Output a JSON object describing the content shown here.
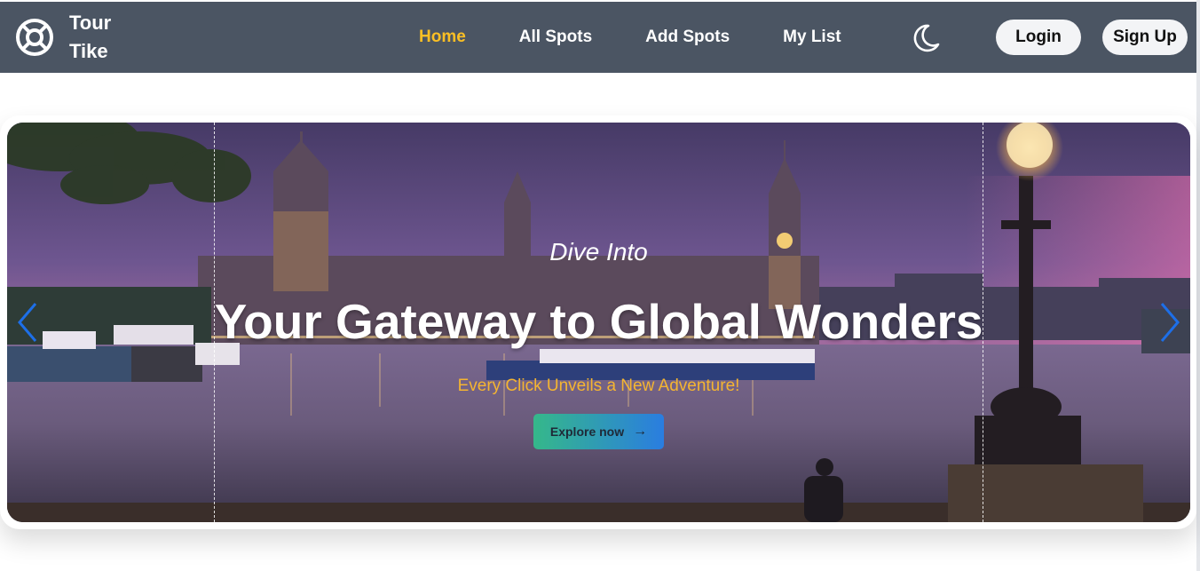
{
  "brand": {
    "line1": "Tour",
    "line2": "Tike",
    "icon": "lifebuoy-icon"
  },
  "nav": {
    "items": [
      {
        "label": "Home",
        "active": true
      },
      {
        "label": "All Spots",
        "active": false
      },
      {
        "label": "Add Spots",
        "active": false
      },
      {
        "label": "My List",
        "active": false
      }
    ],
    "theme_icon": "moon-icon",
    "login_label": "Login",
    "signup_label": "Sign Up"
  },
  "hero": {
    "subtitle": "Dive Into",
    "title": "Your Gateway to Global Wonders",
    "tagline": "Every Click Unveils a New Adventure!",
    "cta_label": "Explore now",
    "cta_icon": "arrow-right-icon",
    "prev_icon": "chevron-left-icon",
    "next_icon": "chevron-right-icon",
    "image_subject": "Houses of Parliament and Big Ben over the Thames at dusk"
  },
  "colors": {
    "nav_bg": "#4b5563",
    "active_link": "#fbbf24",
    "tagline": "#f5b531",
    "cta_gradient_start": "#35b88a",
    "cta_gradient_end": "#2a7de0",
    "carousel_arrow": "#1d6fe8"
  }
}
